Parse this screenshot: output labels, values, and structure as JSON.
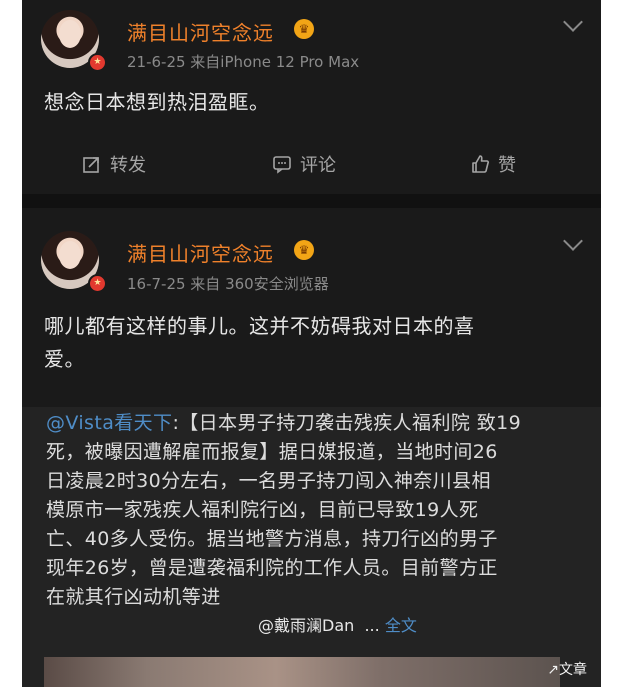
{
  "posts": [
    {
      "user": "满目山河空念远",
      "meta": "21-6-25  来自iPhone 12 Pro Max",
      "text": "想念日本想到热泪盈眶。",
      "actions": {
        "repost": "转发",
        "comment": "评论",
        "like": "赞"
      }
    },
    {
      "user": "满目山河空念远",
      "meta": "16-7-25  来自 360安全浏览器",
      "text_line1": "哪儿都有这样的事儿。这并不妨碍我对日本的喜",
      "text_line2": "爱。",
      "repost": {
        "mention": "@Vista看天下",
        "lines": [
          ":【日本男子持刀袭击残疾人福利院 致19",
          "死，被曝因遭解雇而报复】据日媒报道，当地时间26",
          "日凌晨2时30分左右，一名男子持刀闯入神奈川县相",
          "模原市一家残疾人福利院行凶，目前已导致19人死",
          "亡、40多人受伤。据当地警方消息，持刀行凶的男子",
          "现年26岁，曾是遭袭福利院的工作人员。目前警方正",
          "在就其行凶动机等进"
        ],
        "watermark": "@戴雨澜Dan",
        "ellipsis": "...",
        "full_text": "全文",
        "doc_tag": "↗文章"
      }
    }
  ],
  "colors": {
    "username": "#f0812b",
    "link": "#4f8dc7",
    "background": "#1a1a1a"
  }
}
